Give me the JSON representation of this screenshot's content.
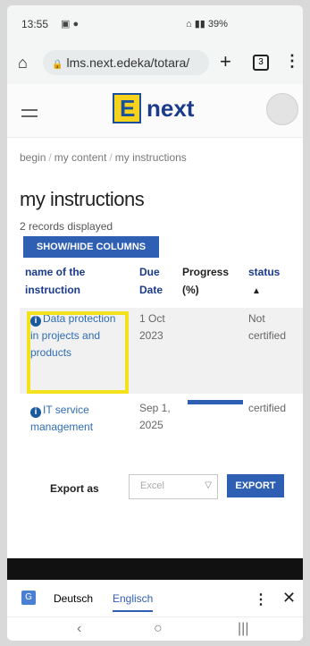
{
  "status_bar": {
    "time": "13:55",
    "right": "39%"
  },
  "browser": {
    "url": "lms.next.edeka/totara/",
    "tab_count": "3"
  },
  "site": {
    "logo_letter": "E",
    "logo_word": "next"
  },
  "breadcrumb": [
    "begin",
    "my content",
    "my instructions"
  ],
  "page_title": "my instructions",
  "records_text": "2 records displayed",
  "show_hide_label": "SHOW/HIDE COLUMNS",
  "table": {
    "headers": {
      "name": "name of the instruction",
      "due": "Due Date",
      "progress": "Progress (%)",
      "status": "status",
      "sort_indicator": "▲"
    },
    "rows": [
      {
        "name": "Data protection in projects and products",
        "due": "1 Oct 2023",
        "progress": null,
        "status": "Not certified"
      },
      {
        "name": "IT service management",
        "due": "Sep 1, 2025",
        "progress": 1.0,
        "status": "certified"
      }
    ]
  },
  "export": {
    "label": "Export as",
    "selected": "Excel",
    "button": "EXPORT"
  },
  "translate_bar": {
    "lang1": "Deutsch",
    "lang2": "Englisch"
  },
  "colors": {
    "accent": "#2e5fb3",
    "highlight": "#f2e11b"
  }
}
